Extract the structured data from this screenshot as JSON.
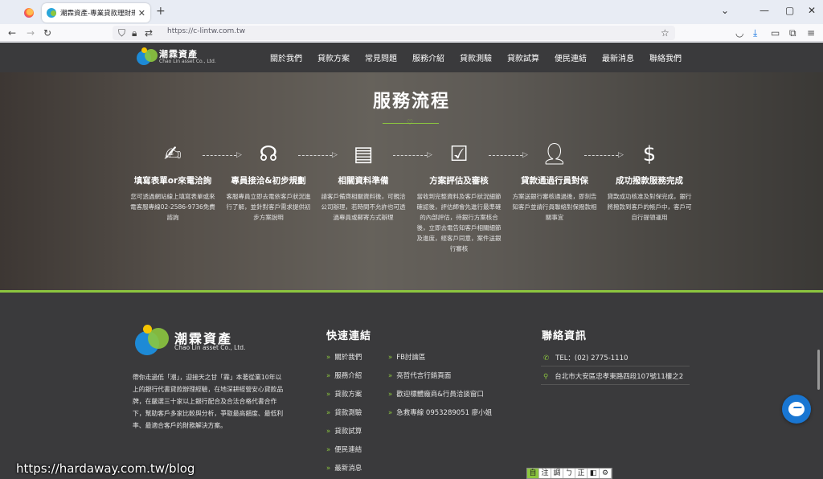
{
  "browser": {
    "tab_title": "潮霖資產-專業貸款理財規劃師",
    "new_tab_glyph": "+",
    "url": "https://c-lintw.com.tw"
  },
  "site": {
    "logo": {
      "name": "潮霖資產",
      "sub": "Chao Lin asset Co., Ltd."
    },
    "nav": [
      "關於我們",
      "貸款方案",
      "常見問題",
      "服務介紹",
      "貸款測驗",
      "貸款試算",
      "便民連結",
      "最新消息",
      "聯絡我們"
    ]
  },
  "process": {
    "title": "服務流程",
    "steps": [
      {
        "icon": "form-edit-icon",
        "title": "填寫表單or來電洽詢",
        "desc": "您可透過網站線上填寫表單或來電客服專線02-2586-9736免費諮詢"
      },
      {
        "icon": "support-agent-icon",
        "title": "專員接洽&初步規劃",
        "desc": "客服專員立即去電依客戶狀況進行了解，並針對客戶需求提供初步方案說明"
      },
      {
        "icon": "documents-icon",
        "title": "相關資料準備",
        "desc": "請客戶備齊相關資料後，可親洽公司辦理，若時間不允許也可透過專員或郵寄方式辦理"
      },
      {
        "icon": "checklist-icon",
        "title": "方案評估及審核",
        "desc": "當收到完整資料及客戶狀況細節確認後，評估師會先進行最準確的內部評估，待銀行方案核合後，立即去電告知客戶相關細節及進度，經客戶同意，案件送銀行審核"
      },
      {
        "icon": "user-icon",
        "title": "貸款通過行員對保",
        "desc": "方案送銀行審核通過後，即刻告知客戶並請行員聯絡對保撥款相關事宜"
      },
      {
        "icon": "money-hand-icon",
        "title": "成功撥款服務完成",
        "desc": "貸款成功核准及對保完成，銀行將撥款到客戶的帳戶中，客戶可自行提領運用"
      }
    ]
  },
  "footer": {
    "logo": {
      "name": "潮霖資產",
      "sub": "Chao Lin asset Co., Ltd."
    },
    "about": "帶你走過低「潮」，迎接天之甘「霖」本著從業10年以上的銀行代書貸款辦理經驗，在地深耕經營安心貸款品牌，在嚴選三十家以上銀行配合及合法合格代書合作下，幫助客戶多家比較與分析，爭取最高額度、最低利率、最適合客戶的財務解決方案。",
    "quick_links_title": "快速連結",
    "quick_links_col1": [
      "關於我們",
      "服務介紹",
      "貸款方案",
      "貸款測驗",
      "貸款試算",
      "便民連結",
      "最新消息"
    ],
    "quick_links_col2": [
      "FB討論區",
      "亮哲代言行銷頁面",
      "歡迎標體廠商&行員洽談窗口",
      "急救專線 0953289051 廖小姐"
    ],
    "contact_title": "聯絡資訊",
    "phone": "TEL：(02) 2775-1110",
    "address": "台北市大安區忠孝東路四段107號11樓之2"
  },
  "a11y_toolbar": [
    "自",
    "注",
    "調",
    "ㄅ",
    "正",
    "◧",
    "⚙"
  ],
  "watermark": "https://hardaway.com.tw/blog",
  "colors": {
    "accent": "#8cc63f",
    "brand_blue": "#1d8ad6",
    "dark_bg": "#3a3a3c"
  }
}
